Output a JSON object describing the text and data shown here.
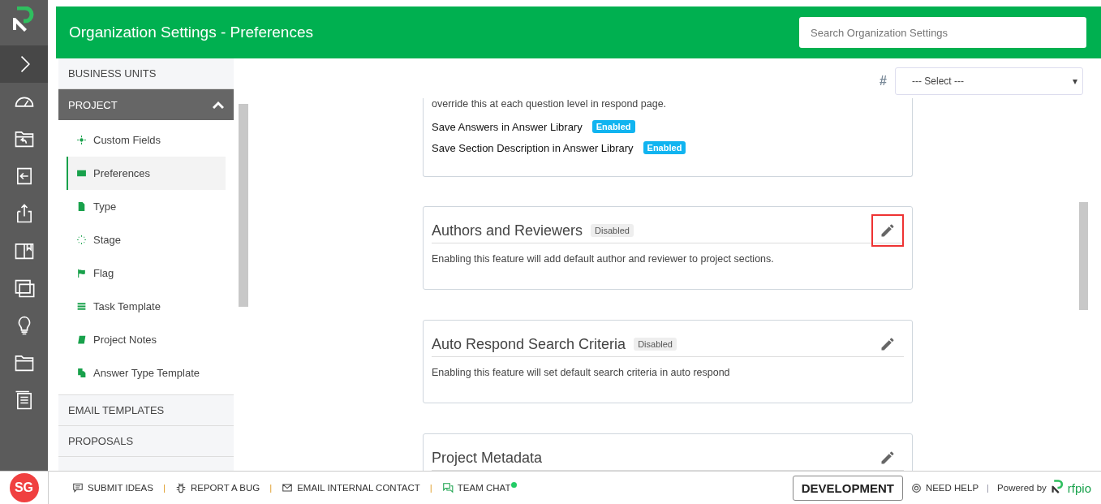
{
  "header": {
    "title": "Organization Settings - Preferences",
    "search": {
      "placeholder": "Search Organization Settings"
    }
  },
  "sidebar": {
    "sections": [
      {
        "label": "BUSINESS UNITS",
        "expanded": false
      },
      {
        "label": "PROJECT",
        "expanded": true,
        "items": [
          {
            "label": "Custom Fields",
            "selected": false
          },
          {
            "label": "Preferences",
            "selected": true
          },
          {
            "label": "Type",
            "selected": false
          },
          {
            "label": "Stage",
            "selected": false
          },
          {
            "label": "Flag",
            "selected": false
          },
          {
            "label": "Task Template",
            "selected": false
          },
          {
            "label": "Project Notes",
            "selected": false
          },
          {
            "label": "Answer Type Template",
            "selected": false
          }
        ]
      },
      {
        "label": "EMAIL TEMPLATES",
        "expanded": false
      },
      {
        "label": "PROPOSALS",
        "expanded": false
      }
    ]
  },
  "filter": {
    "symbol": "#",
    "placeholder": "--- Select ---",
    "caret": "▾"
  },
  "cards": [
    {
      "description": "override this at each question level in respond page.",
      "settings": [
        {
          "label": "Save Answers in Answer Library",
          "status": "Enabled",
          "enabled": true
        },
        {
          "label": "Save Section Description in Answer Library",
          "status": "Enabled",
          "enabled": true
        }
      ]
    },
    {
      "title": "Authors and Reviewers",
      "status": "Disabled",
      "enabled": false,
      "highlighted": true,
      "description": "Enabling this feature will add default author and reviewer to project sections."
    },
    {
      "title": "Auto Respond Search Criteria",
      "status": "Disabled",
      "enabled": false,
      "highlighted": false,
      "description": "Enabling this feature will set default search criteria in auto respond"
    },
    {
      "title": "Project Metadata",
      "highlighted": false
    }
  ],
  "footer": {
    "avatar": "SG",
    "links": [
      {
        "label": "SUBMIT IDEAS"
      },
      {
        "label": "REPORT A BUG"
      },
      {
        "label": "EMAIL INTERNAL CONTACT"
      },
      {
        "label": "TEAM CHAT",
        "online": true
      }
    ],
    "separator": "|",
    "environment": "DEVELOPMENT",
    "help": "NEED HELP",
    "powered_by": "Powered by",
    "brand": "rfpio"
  }
}
